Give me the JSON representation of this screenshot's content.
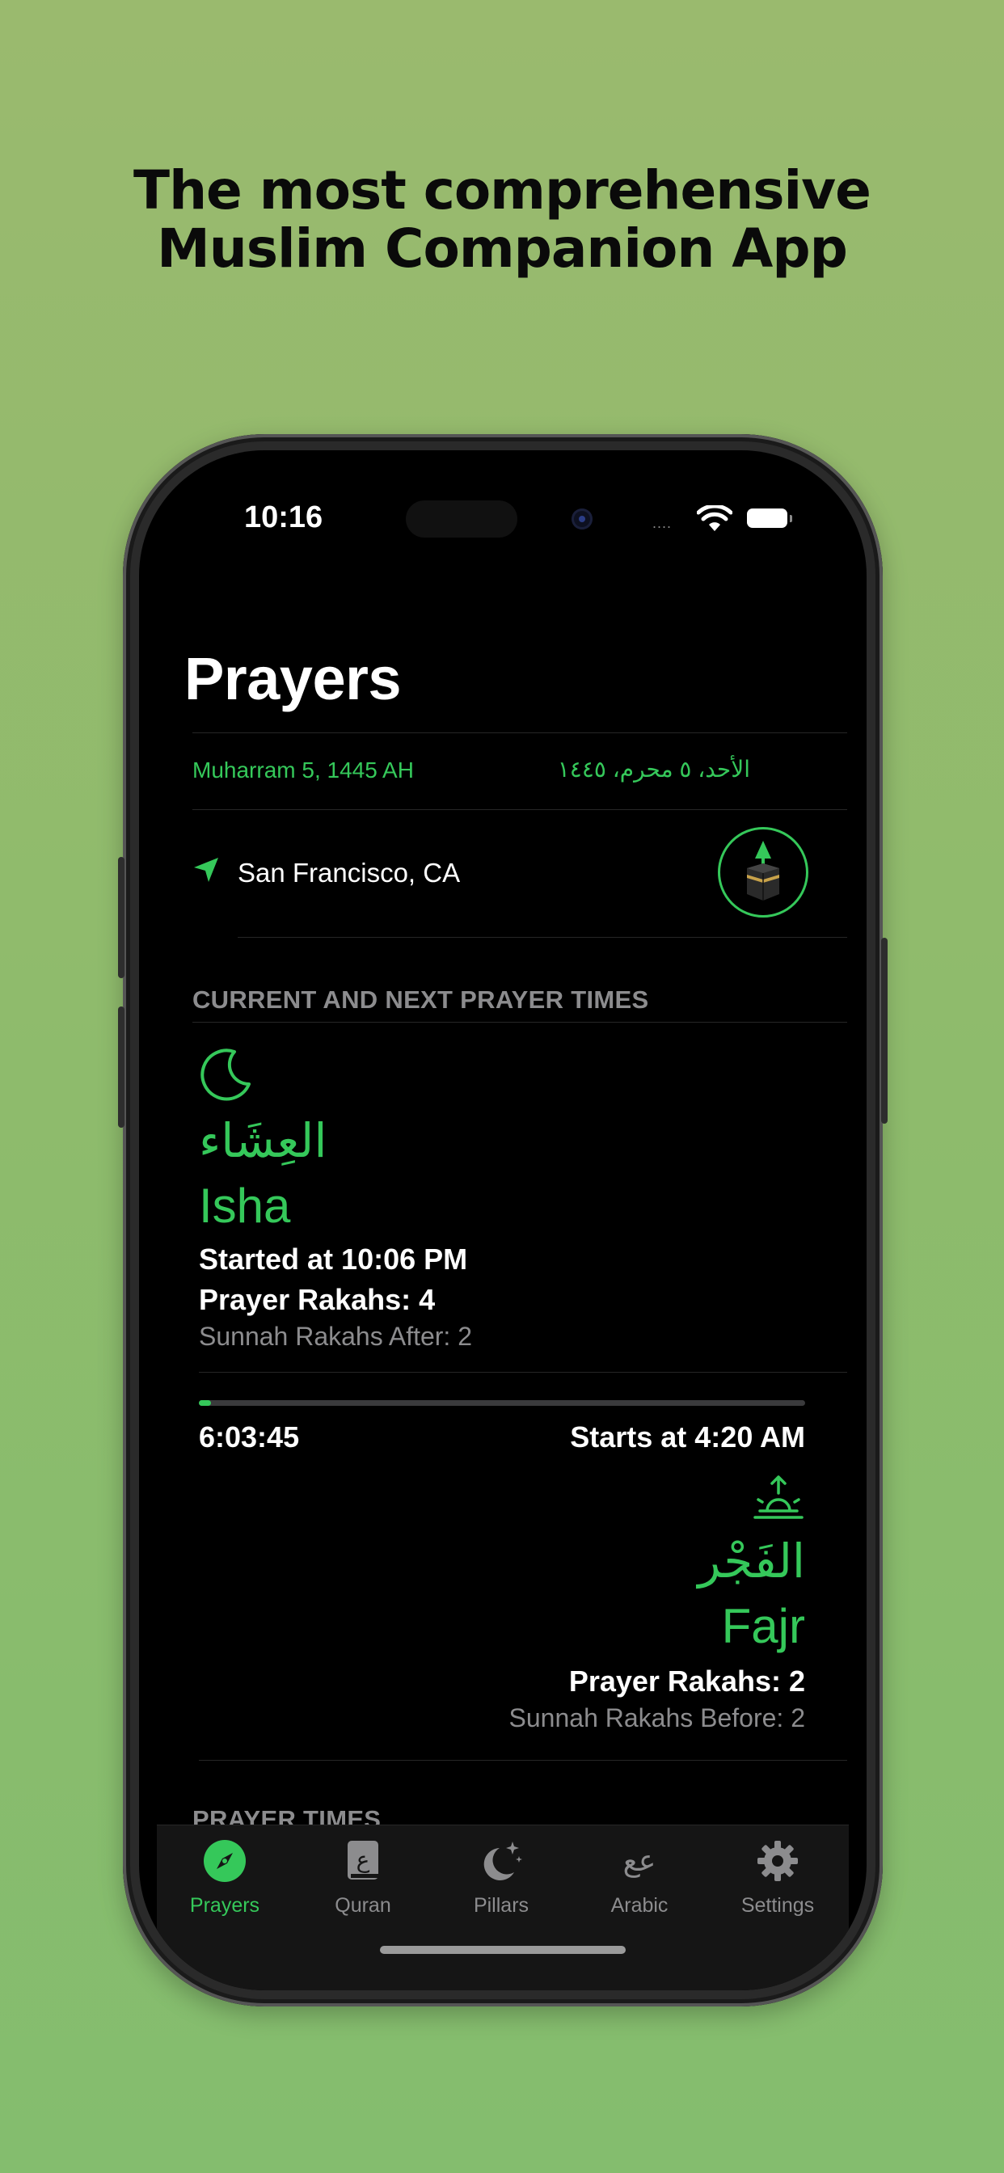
{
  "promo": {
    "headline_line1": "The most comprehensive",
    "headline_line2": "Muslim Companion App"
  },
  "status_bar": {
    "time": "10:16",
    "signal": "....",
    "wifi_icon": "wifi-icon",
    "battery_icon": "battery-icon"
  },
  "page": {
    "title": "Prayers"
  },
  "date": {
    "hijri_english": "Muharram 5, 1445 AH",
    "hijri_arabic": "الأحد، ٥ محرم، ١٤٤٥"
  },
  "location": {
    "icon": "location-arrow-icon",
    "city": "San Francisco, CA",
    "qibla_icon": "kaaba-qibla-compass-icon"
  },
  "sections": {
    "current_next_header": "CURRENT AND NEXT PRAYER TIMES",
    "prayer_times_header": "PRAYER TIMES"
  },
  "current_prayer": {
    "icon": "crescent-moon-icon",
    "name_arabic": "العِشَاء",
    "name_english": "Isha",
    "started_at": "Started at 10:06 PM",
    "rakahs": "Prayer Rakahs: 4",
    "sunnah": "Sunnah Rakahs After: 2"
  },
  "progress": {
    "elapsed_fraction": 0.012,
    "countdown": "6:03:45"
  },
  "next_prayer": {
    "icon": "sunrise-icon",
    "starts_at": "Starts at 4:20 AM",
    "name_arabic": "الفَجْر",
    "name_english": "Fajr",
    "rakahs": "Prayer Rakahs: 2",
    "sunnah": "Sunnah Rakahs Before: 2"
  },
  "tab_bar": {
    "items": [
      {
        "label": "Prayers",
        "icon": "compass-icon",
        "active": true
      },
      {
        "label": "Quran",
        "icon": "book-icon",
        "active": false
      },
      {
        "label": "Pillars",
        "icon": "moon-stars-icon",
        "active": false
      },
      {
        "label": "Arabic",
        "icon": "arabic-letters-icon",
        "active": false
      },
      {
        "label": "Settings",
        "icon": "gear-icon",
        "active": false
      }
    ]
  },
  "colors": {
    "accent": "#35c85a",
    "background": "#000000",
    "secondary_text": "#8c8c8e",
    "promo_background": "#8ebb6c"
  }
}
